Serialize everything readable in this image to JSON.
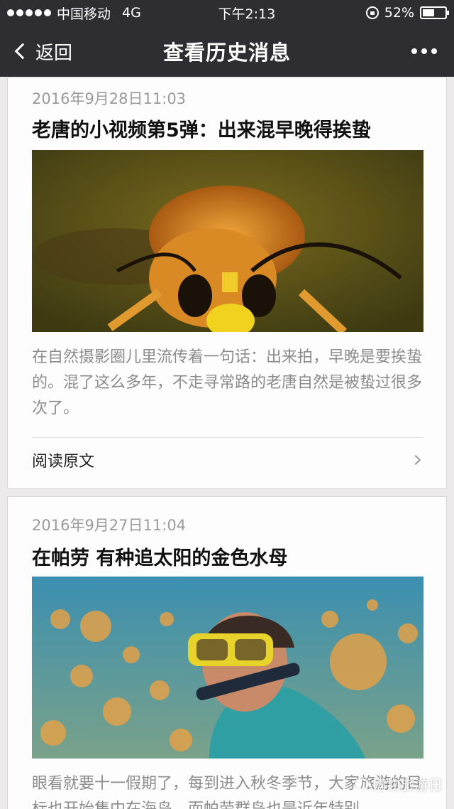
{
  "status_bar": {
    "carrier": "中国移动",
    "network": "4G",
    "time": "下午2:13",
    "battery_percent": "52%",
    "battery_level": 0.52
  },
  "nav": {
    "back_label": "返回",
    "title": "查看历史消息",
    "more_icon": "more-dots-icon"
  },
  "articles": [
    {
      "date": "2016年9月28日11:03",
      "title": "老唐的小视频第5弹：出来混早晚得挨蛰",
      "image_icon": "wasp-photo",
      "summary": "在自然摄影圈儿里流传着一句话：出来拍，早晚是要挨蛰的。混了这么多年，不走寻常路的老唐自然是被蛰过很多次了。",
      "read_more": "阅读原文"
    },
    {
      "date": "2016年9月27日11:04",
      "title": "在帕劳 有种追太阳的金色水母",
      "image_icon": "snorkeler-jellyfish-photo",
      "summary": "眼看就要十一假期了，每到进入秋冬季节，大家旅游的目标也开始集中在海岛，而帕劳群岛也是近年特别"
    }
  ],
  "watermark": "博物旅游日"
}
